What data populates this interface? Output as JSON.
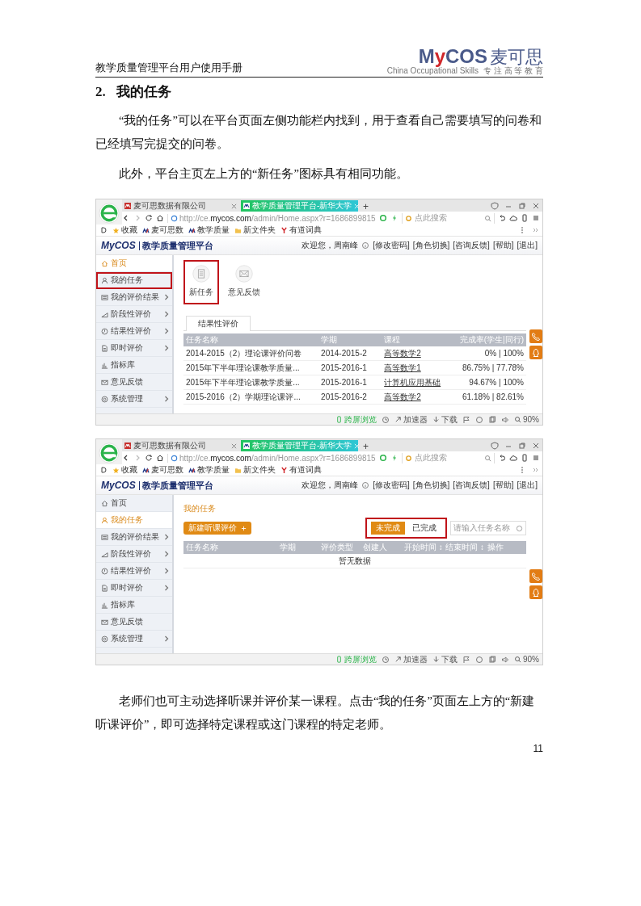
{
  "header": {
    "title": "教学质量管理平台用户使用手册",
    "logo_prefix": "M",
    "logo_accent": "y",
    "logo_suffix": "COS",
    "logo_cn": "麦可思",
    "logo_tagline": "China Occupational Skills",
    "logo_motto": "专 注 高 等 教 育"
  },
  "section": {
    "number": "2.",
    "title": "我的任务"
  },
  "paragraphs": [
    "“我的任务”可以在平台页面左侧功能栏内找到，用于查看自己需要填写的问卷和已经填写完提交的问卷。",
    "此外，平台主页左上方的“新任务”图标具有相同功能。"
  ],
  "screenshots": [
    {
      "tabs": [
        {
          "label": "麦可思数据有限公司",
          "selected": false
        },
        {
          "label": "教学质量管理平台-新华大学",
          "selected": true
        }
      ],
      "new_tab": "+",
      "url": "http://ce.**mycos.com**/admin/Home.aspx?r=1686899815",
      "search_placeholder": "点此搜索",
      "bookmarks": [
        "收藏",
        "麦可思数",
        "教学质量",
        "新文件夹",
        "有道词典"
      ],
      "brand": "MyCOS",
      "platform": "教学质量管理平台",
      "welcome": "欢迎您，周南峰",
      "user_links": [
        "[修改密码]",
        "[角色切换]",
        "[咨询反馈]",
        "[帮助]",
        "[退出]"
      ],
      "sidebar": [
        {
          "label": "首页",
          "selected": true,
          "expandable": false,
          "highlighted": false
        },
        {
          "label": "我的任务",
          "selected": false,
          "expandable": false,
          "highlighted": true
        },
        {
          "label": "我的评价结果",
          "selected": false,
          "expandable": true,
          "highlighted": false
        },
        {
          "label": "阶段性评价",
          "selected": false,
          "expandable": true,
          "highlighted": false
        },
        {
          "label": "结果性评价",
          "selected": false,
          "expandable": true,
          "highlighted": false
        },
        {
          "label": "即时评价",
          "selected": false,
          "expandable": true,
          "highlighted": false
        },
        {
          "label": "指标库",
          "selected": false,
          "expandable": false,
          "highlighted": false
        },
        {
          "label": "意见反馈",
          "selected": false,
          "expandable": false,
          "highlighted": false
        },
        {
          "label": "系统管理",
          "selected": false,
          "expandable": true,
          "highlighted": false
        }
      ],
      "content": {
        "kind": "home",
        "shortcuts": [
          {
            "label": "新任务",
            "highlighted": true
          },
          {
            "label": "意见反馈",
            "highlighted": false
          }
        ],
        "tabs": [
          {
            "label": "结果性评价",
            "selected": true
          }
        ],
        "columns": [
          "任务名称",
          "学期",
          "课程",
          "完成率(学生|同行)"
        ],
        "rows": [
          {
            "name": "2014-2015（2）理论课评价问卷",
            "term": "2014-2015-2",
            "course": "高等数学2",
            "rate": "0% | 100%"
          },
          {
            "name": "2015年下半年理论课教学质量...",
            "term": "2015-2016-1",
            "course": "高等数学1",
            "rate": "86.75% | 77.78%"
          },
          {
            "name": "2015年下半年理论课教学质量...",
            "term": "2015-2016-1",
            "course": "计算机应用基础",
            "rate": "94.67% | 100%"
          },
          {
            "name": "2015-2016（2）学期理论课评...",
            "term": "2015-2016-2",
            "course": "高等数学2",
            "rate": "61.18% | 82.61%"
          }
        ]
      },
      "status": [
        "跨屏浏览",
        "加速器",
        "下载",
        "90%"
      ]
    },
    {
      "tabs": [
        {
          "label": "麦可思数据有限公司",
          "selected": false
        },
        {
          "label": "教学质量管理平台-新华大学",
          "selected": true
        }
      ],
      "new_tab": "+",
      "url": "http://ce.**mycos.com**/admin/Home.aspx?r=1686899815",
      "search_placeholder": "点此搜索",
      "bookmarks": [
        "收藏",
        "麦可思数",
        "教学质量",
        "新文件夹",
        "有道词典"
      ],
      "brand": "MyCOS",
      "platform": "教学质量管理平台",
      "welcome": "欢迎您，周南峰",
      "user_links": [
        "[修改密码]",
        "[角色切换]",
        "[咨询反馈]",
        "[帮助]",
        "[退出]"
      ],
      "sidebar": [
        {
          "label": "首页",
          "selected": false,
          "expandable": false,
          "highlighted": false
        },
        {
          "label": "我的任务",
          "selected": true,
          "expandable": false,
          "highlighted": false
        },
        {
          "label": "我的评价结果",
          "selected": false,
          "expandable": true,
          "highlighted": false
        },
        {
          "label": "阶段性评价",
          "selected": false,
          "expandable": true,
          "highlighted": false
        },
        {
          "label": "结果性评价",
          "selected": false,
          "expandable": true,
          "highlighted": false
        },
        {
          "label": "即时评价",
          "selected": false,
          "expandable": true,
          "highlighted": false
        },
        {
          "label": "指标库",
          "selected": false,
          "expandable": false,
          "highlighted": false
        },
        {
          "label": "意见反馈",
          "selected": false,
          "expandable": false,
          "highlighted": false
        },
        {
          "label": "系统管理",
          "selected": false,
          "expandable": true,
          "highlighted": false
        }
      ],
      "content": {
        "kind": "tasks",
        "heading": "我的任务",
        "new_button": "新建听课评价",
        "filters_highlighted": true,
        "filters": [
          {
            "label": "未完成",
            "selected": true
          },
          {
            "label": "已完成",
            "selected": false
          }
        ],
        "search_placeholder": "请输入任务名称",
        "columns": [
          "任务名称",
          "学期",
          "评价类型",
          "创建人",
          "开始时间 ↕",
          "结束时间 ↕",
          "操作"
        ],
        "empty": "暂无数据"
      },
      "status": [
        "跨屏浏览",
        "加速器",
        "下载",
        "90%"
      ]
    }
  ],
  "closing_paragraph": "老师们也可主动选择听课并评价某一课程。点击“我的任务”页面左上方的“新建听课评价”，即可选择特定课程或这门课程的特定老师。",
  "page_number": "11"
}
